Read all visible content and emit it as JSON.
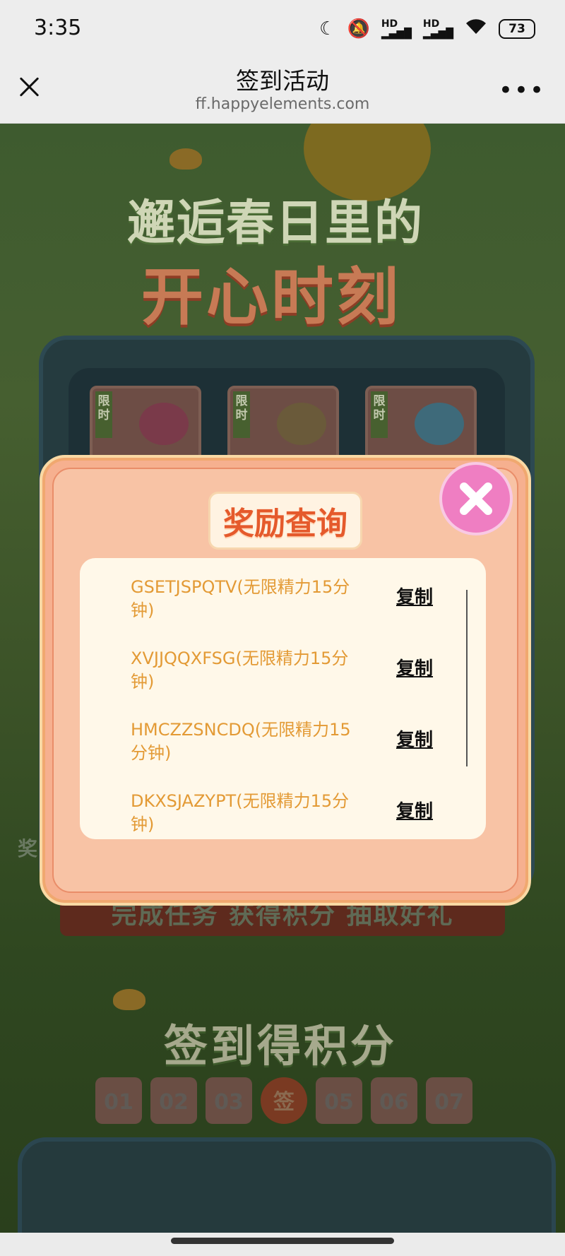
{
  "status_bar": {
    "time": "3:35",
    "icons": [
      "moon-icon",
      "mute-icon",
      "hd-signal-icon",
      "hd-signal-icon",
      "wifi-icon"
    ],
    "battery": "73"
  },
  "navbar": {
    "title": "签到活动",
    "url": "ff.happyelements.com",
    "more": "•••"
  },
  "background": {
    "headline_line1": "邂逅春日里的",
    "headline_line2": "开心时刻",
    "card_tag": "限时",
    "side_label": "奖",
    "ribbon_text": "完成任务 获得积分 抽取好礼",
    "section_title": "签到得积分",
    "days": [
      "01",
      "02",
      "03",
      "签",
      "05",
      "06",
      "07"
    ]
  },
  "modal": {
    "title": "奖励查询",
    "copy_label": "复制",
    "items": [
      {
        "code": "GSETJSPQTV(无限精力15分钟)"
      },
      {
        "code": "XVJJQQXFSG(无限精力15分钟)"
      },
      {
        "code": "HMCZZSNCDQ(无限精力15分钟)"
      },
      {
        "code": "DKXSJAZYPT(无限精力15分钟)"
      }
    ]
  },
  "colors": {
    "modal_bg": "#f6b08f",
    "title_text": "#e55a2c",
    "code_text": "#e39a35",
    "close_button": "#ef7ec2"
  }
}
